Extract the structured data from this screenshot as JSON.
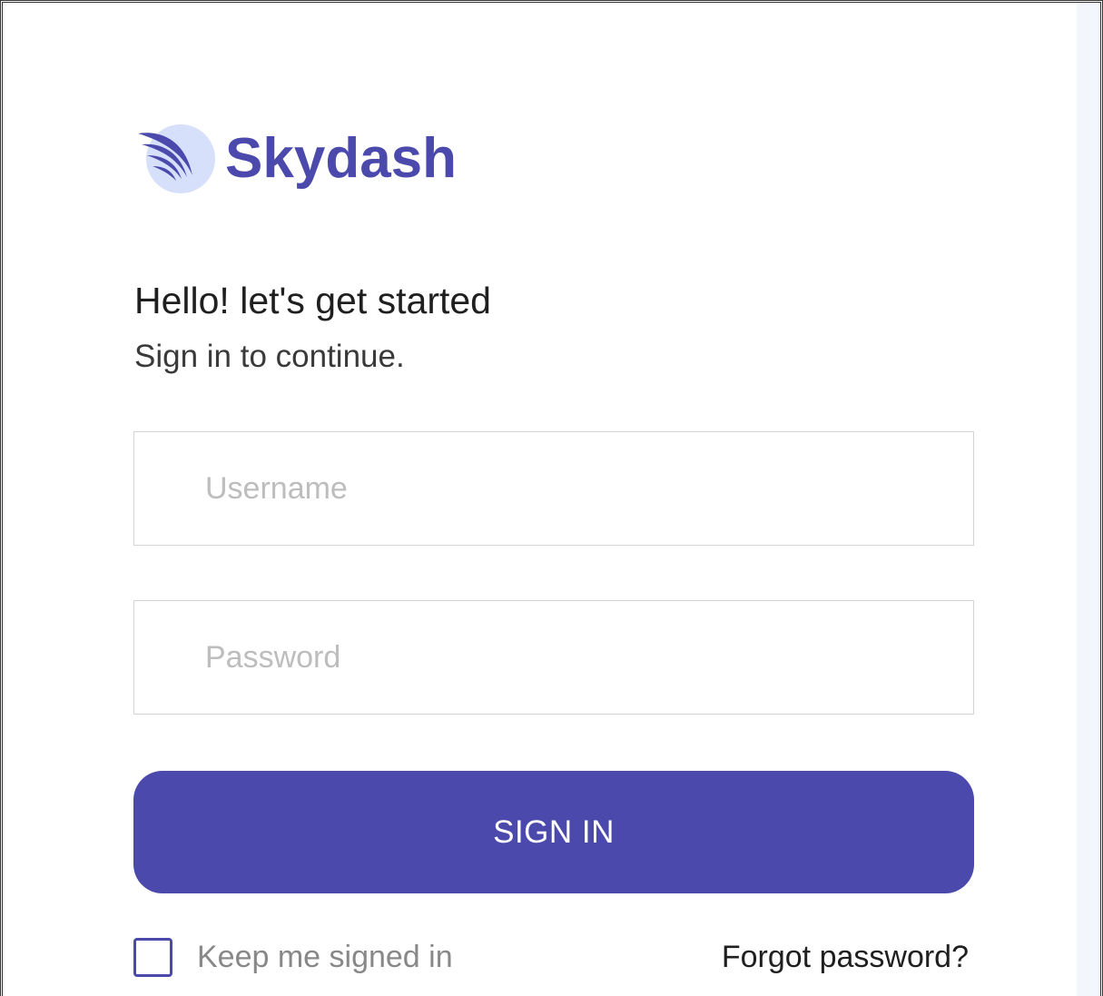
{
  "brand": {
    "name": "Skydash",
    "color": "#4b49ac",
    "icon": "wing-logo-icon"
  },
  "heading": {
    "title": "Hello! let's get started",
    "subtitle": "Sign in to continue."
  },
  "form": {
    "username": {
      "placeholder": "Username",
      "value": ""
    },
    "password": {
      "placeholder": "Password",
      "value": ""
    },
    "submit_label": "SIGN IN",
    "keep_signed_in": {
      "label": "Keep me signed in",
      "checked": false
    },
    "forgot_label": "Forgot password?"
  }
}
